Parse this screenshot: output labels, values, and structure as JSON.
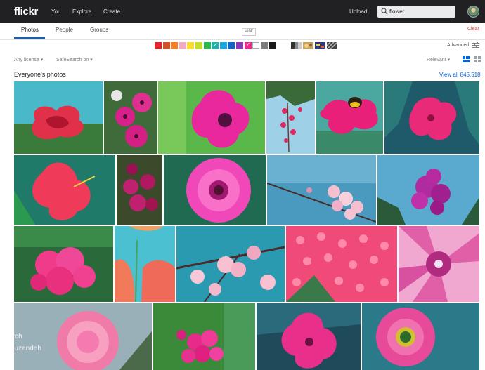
{
  "nav": {
    "logo": "flickr",
    "links": [
      "You",
      "Explore",
      "Create"
    ],
    "upload": "Upload",
    "search_value": "flower"
  },
  "tabs": {
    "items": [
      "Photos",
      "People",
      "Groups"
    ],
    "active": "Photos",
    "clear": "Clear"
  },
  "colors": {
    "tooltip": "Pink",
    "swatches": [
      "#e3262d",
      "#d2502a",
      "#f57f20",
      "#f4aac6",
      "#f9dc2e",
      "#c7dc2c",
      "#2db84b",
      "#1fb2a8",
      "#1ba8e0",
      "#1466c2",
      "#8a3ab9",
      "#ec2a8d",
      "#ffffff",
      "#7d7d7d",
      "#1a1a1a"
    ],
    "selected": "#ec2a8d",
    "advanced": "Advanced",
    "accent": "#0063dc"
  },
  "filters": {
    "license": "Any license",
    "safesearch": "SafeSearch on",
    "sort": "Relevant"
  },
  "section": {
    "title": "Everyone's photos",
    "view_all": "View all 845,518"
  },
  "overlay": {
    "line1": "Search",
    "line2": "Forouzandeh"
  }
}
